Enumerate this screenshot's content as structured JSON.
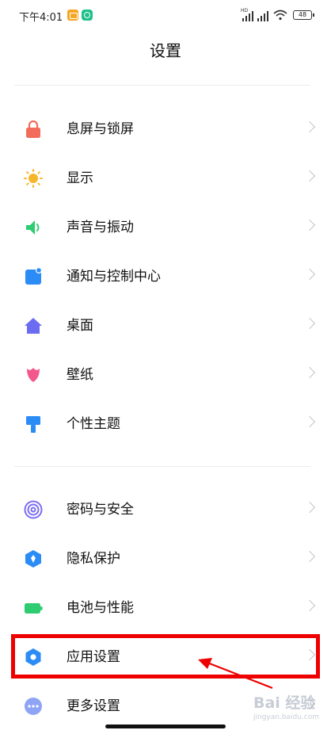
{
  "status_bar": {
    "time": "下午4:01",
    "hd_label": "HD",
    "battery": "48",
    "icons": [
      "app-notification-icon",
      "app-notification-icon",
      "signal-icon",
      "signal-icon",
      "wifi-icon",
      "battery-icon"
    ]
  },
  "header": {
    "title": "设置"
  },
  "sections": [
    {
      "items": [
        {
          "label": "息屏与锁屏",
          "icon": "lock-icon",
          "color": "#f26b5b"
        },
        {
          "label": "显示",
          "icon": "brightness-icon",
          "color": "#f7b52c"
        },
        {
          "label": "声音与振动",
          "icon": "speaker-icon",
          "color": "#2ecc71"
        },
        {
          "label": "通知与控制中心",
          "icon": "notification-icon",
          "color": "#2b8cf6"
        },
        {
          "label": "桌面",
          "icon": "home-icon",
          "color": "#6b6cf2"
        },
        {
          "label": "壁纸",
          "icon": "tulip-icon",
          "color": "#f2588a"
        },
        {
          "label": "个性主题",
          "icon": "paint-brush-icon",
          "color": "#2b8cf6"
        }
      ]
    },
    {
      "items": [
        {
          "label": "密码与安全",
          "icon": "fingerprint-icon",
          "color": "#7b6cf2"
        },
        {
          "label": "隐私保护",
          "icon": "privacy-shield-icon",
          "color": "#2b8cf6"
        },
        {
          "label": "电池与性能",
          "icon": "battery-icon",
          "color": "#2ecc71"
        },
        {
          "label": "应用设置",
          "icon": "gear-icon",
          "color": "#2b8cf6",
          "highlighted": true
        },
        {
          "label": "更多设置",
          "icon": "more-icon",
          "color": "#8fa4f5"
        }
      ]
    }
  ],
  "annotation": {
    "highlight_color": "#ee0000"
  },
  "watermark": {
    "text": "Bai 经验",
    "sub": "jingyan.baidu.com"
  }
}
